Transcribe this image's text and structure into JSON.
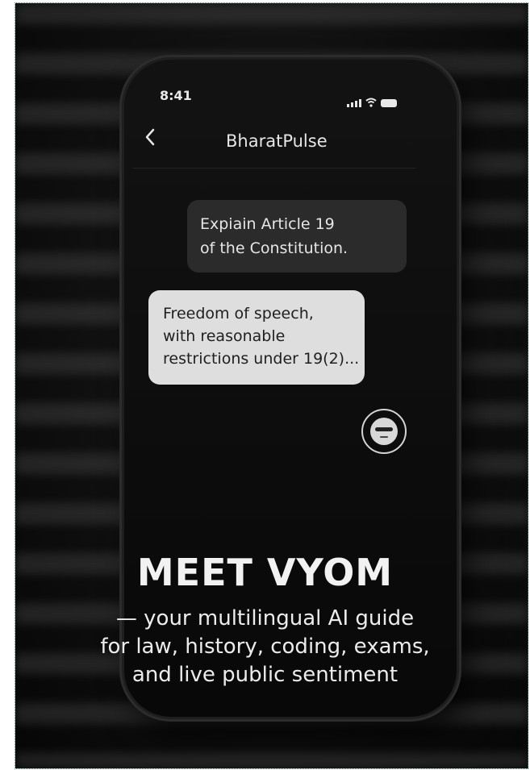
{
  "status": {
    "time": "8:41"
  },
  "app": {
    "title": "BharatPulse"
  },
  "icons": {
    "back": "chevron-left-icon",
    "signal": "signal-icon",
    "wifi": "wifi-icon",
    "battery": "battery-icon",
    "avatar": "bot-face-icon"
  },
  "chat": {
    "user_message": [
      "Expiain Article 19",
      "of the Constitution."
    ],
    "bot_message": [
      "Freedom of speech,",
      "with reasonable",
      "restrictions under 19(2)..."
    ]
  },
  "promo": {
    "headline": "MEET VYOM",
    "subtitle": [
      "— your multilingual AI guide",
      "for law, history, coding, exams,",
      "and live public sentiment"
    ]
  }
}
